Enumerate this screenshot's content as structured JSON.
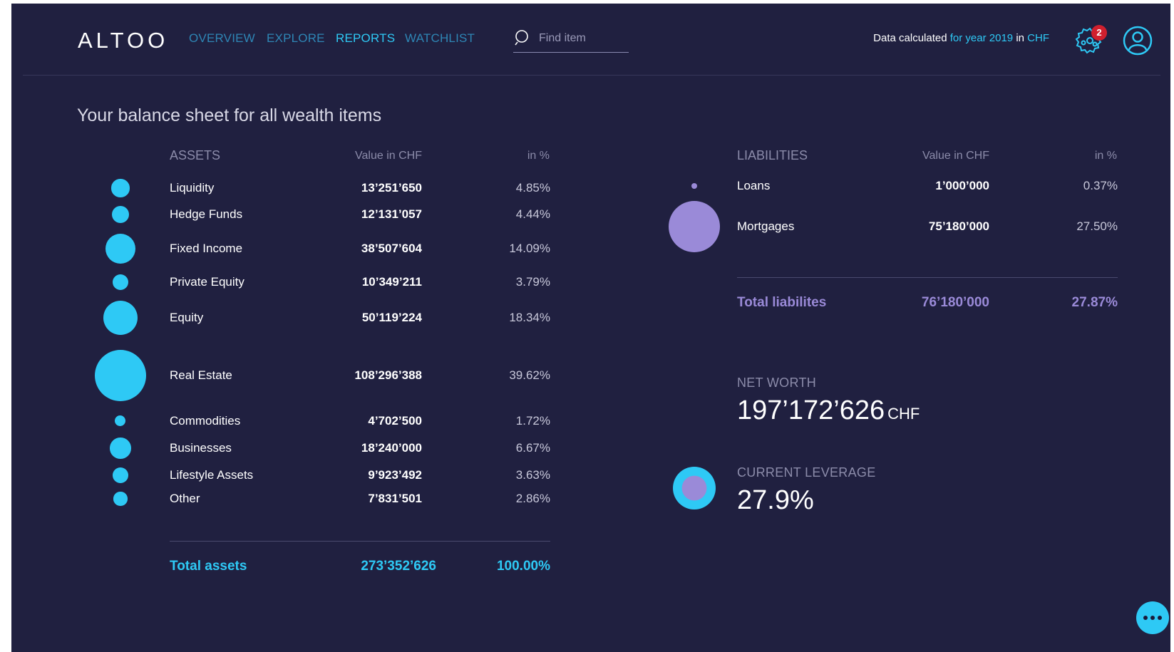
{
  "header": {
    "logo": "ALTOO",
    "nav": [
      "OVERVIEW",
      "EXPLORE",
      "REPORTS",
      "WATCHLIST"
    ],
    "active_nav": "REPORTS",
    "search_placeholder": "Find item",
    "data_calc": {
      "prefix": "Data calculated",
      "period": "for year 2019",
      "in": "in",
      "currency": "CHF"
    },
    "notification_count": "2"
  },
  "title": "Your balance sheet for all wealth items",
  "assets": {
    "heading": "ASSETS",
    "value_col": "Value in CHF",
    "pct_col": "in %",
    "rows": [
      {
        "name": "Liquidity",
        "value": "13’251’650",
        "pct": "4.85%",
        "share": 4.85
      },
      {
        "name": "Hedge Funds",
        "value": "12’131’057",
        "pct": "4.44%",
        "share": 4.44
      },
      {
        "name": "Fixed Income",
        "value": "38’507’604",
        "pct": "14.09%",
        "share": 14.09
      },
      {
        "name": "Private Equity",
        "value": "10’349’211",
        "pct": "3.79%",
        "share": 3.79
      },
      {
        "name": "Equity",
        "value": "50’119’224",
        "pct": "18.34%",
        "share": 18.34
      },
      {
        "name": "Real Estate",
        "value": "108’296’388",
        "pct": "39.62%",
        "share": 39.62
      },
      {
        "name": "Commodities",
        "value": "4’702’500",
        "pct": "1.72%",
        "share": 1.72
      },
      {
        "name": "Businesses",
        "value": "18’240’000",
        "pct": "6.67%",
        "share": 6.67
      },
      {
        "name": "Lifestyle Assets",
        "value": "9’923’492",
        "pct": "3.63%",
        "share": 3.63
      },
      {
        "name": "Other",
        "value": "7’831’501",
        "pct": "2.86%",
        "share": 2.86
      }
    ],
    "total_label": "Total assets",
    "total_value": "273’352’626",
    "total_pct": "100.00%"
  },
  "liabilities": {
    "heading": "LIABILITIES",
    "value_col": "Value in CHF",
    "pct_col": "in %",
    "rows": [
      {
        "name": "Loans",
        "value": "1’000’000",
        "pct": "0.37%",
        "share": 0.37
      },
      {
        "name": "Mortgages",
        "value": "75’180’000",
        "pct": "27.50%",
        "share": 27.5
      }
    ],
    "total_label": "Total liabilites",
    "total_value": "76’180’000",
    "total_pct": "27.87%"
  },
  "net_worth": {
    "label": "NET WORTH",
    "value": "197’172’626",
    "unit": "CHF"
  },
  "leverage": {
    "label": "CURRENT LEVERAGE",
    "value": "27.9%",
    "fraction": 0.279
  },
  "colors": {
    "background": "#202040",
    "accent": "#2ec9f5",
    "nav_inactive": "#2e86b5",
    "liability": "#9a8ad8",
    "badge": "#d0202e"
  },
  "icons": {
    "search": "search-icon",
    "settings": "gear-icon",
    "user": "user-icon",
    "chat": "more-dots-icon"
  }
}
